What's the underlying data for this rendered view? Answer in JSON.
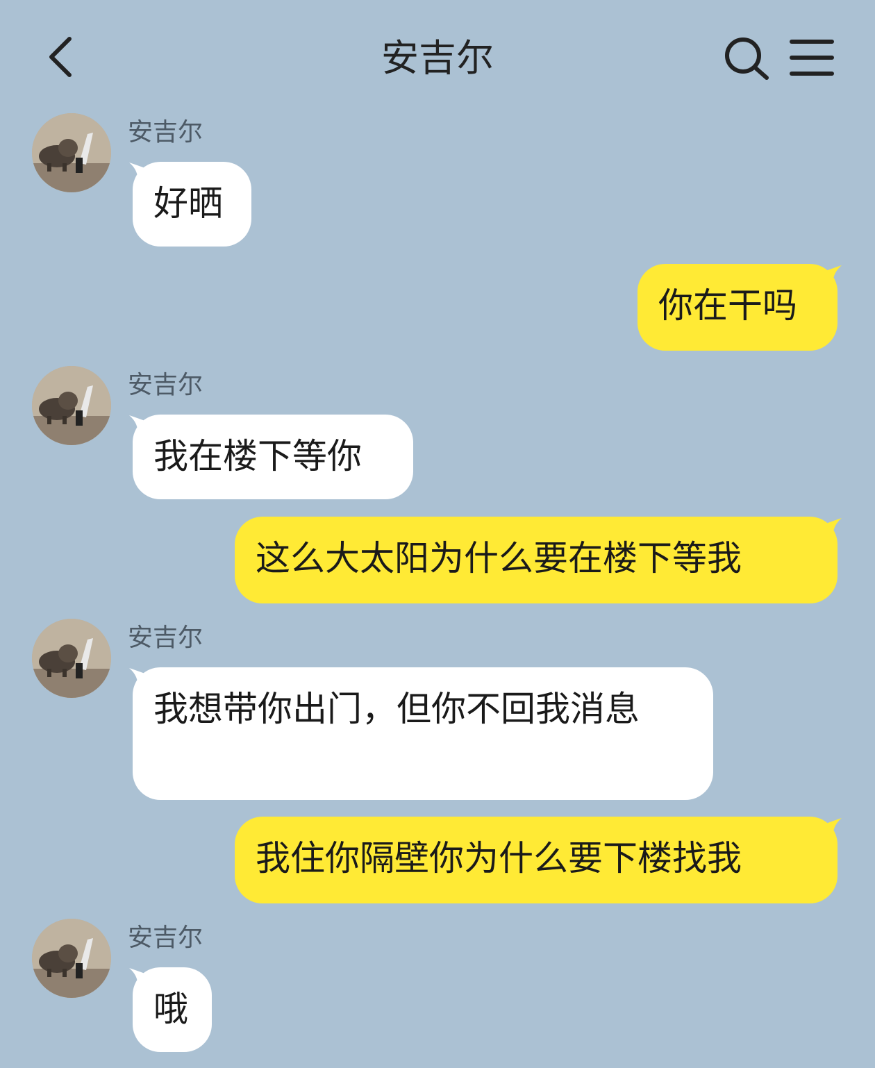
{
  "header": {
    "title": "安吉尔",
    "back_icon": "chevron-left-icon",
    "search_icon": "search-icon",
    "menu_icon": "menu-icon"
  },
  "colors": {
    "background": "#abc1d3",
    "incoming_bubble": "#ffffff",
    "outgoing_bubble": "#ffea35"
  },
  "messages": [
    {
      "direction": "incoming",
      "sender": "安吉尔",
      "text": "好晒"
    },
    {
      "direction": "outgoing",
      "text": "你在干吗"
    },
    {
      "direction": "incoming",
      "sender": "安吉尔",
      "text": "我在楼下等你"
    },
    {
      "direction": "outgoing",
      "text": "这么大太阳为什么要在楼下等我"
    },
    {
      "direction": "incoming",
      "sender": "安吉尔",
      "text": "我想带你出门，但你不回我消息"
    },
    {
      "direction": "outgoing",
      "text": "我住你隔壁你为什么要下楼找我"
    },
    {
      "direction": "incoming",
      "sender": "安吉尔",
      "text": "哦"
    }
  ]
}
